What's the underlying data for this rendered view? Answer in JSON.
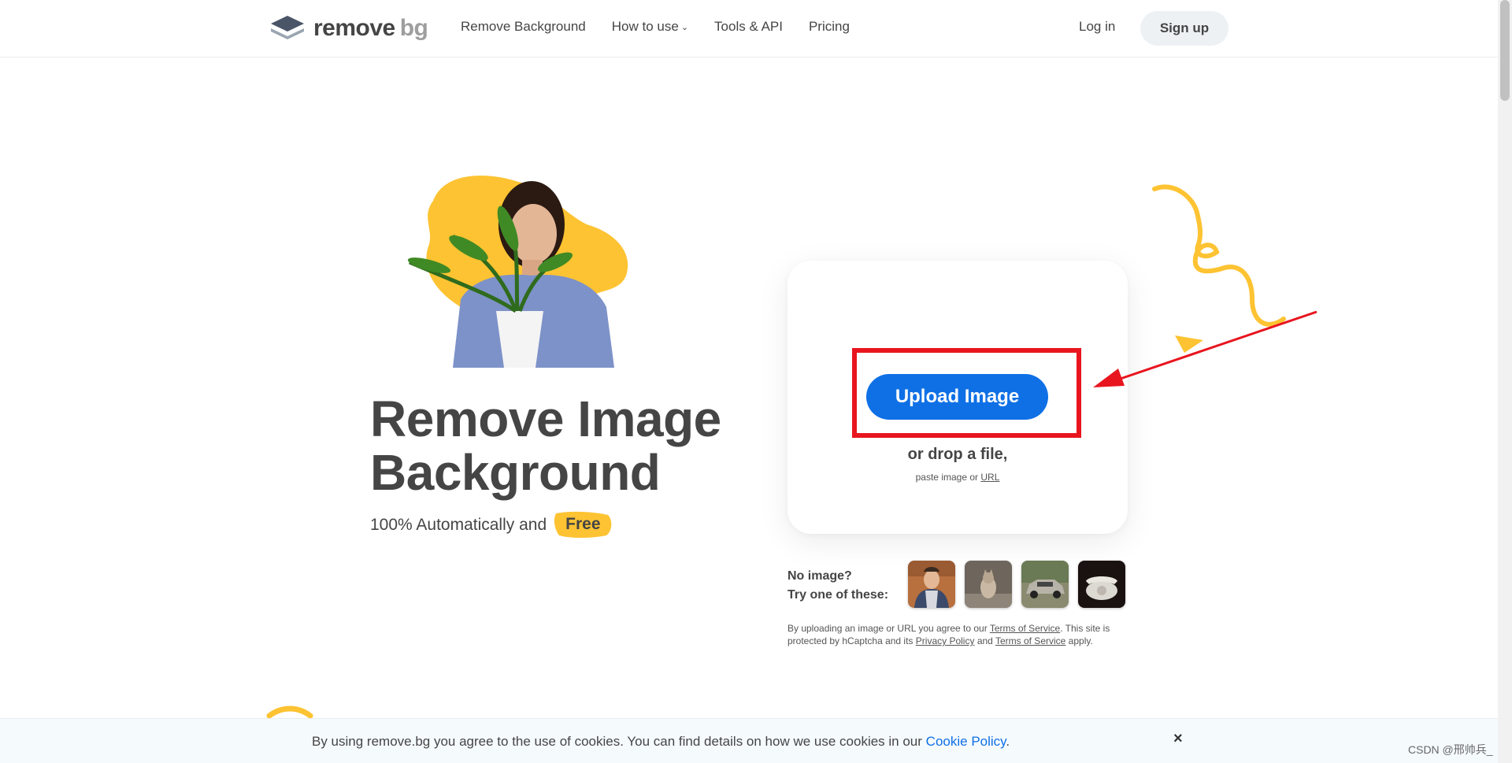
{
  "nav": {
    "logo_word1": "remove",
    "logo_word2": "bg",
    "links": [
      "Remove Background",
      "How to use",
      "Tools & API",
      "Pricing"
    ],
    "login": "Log in",
    "signup": "Sign up"
  },
  "hero": {
    "title_line1": "Remove Image",
    "title_line2": "Background",
    "subtitle": "100% Automatically and",
    "free": "Free"
  },
  "upload": {
    "button": "Upload Image",
    "drop_text": "or drop a file,",
    "paste_prefix": "paste image or",
    "url_link": "URL"
  },
  "samples": {
    "line1": "No image?",
    "line2": "Try one of these:",
    "items": [
      "person",
      "cat",
      "car",
      "telephone"
    ]
  },
  "terms": {
    "t1": "By uploading an image or URL you agree to our",
    "link1": "Terms of Service",
    "t2": ". This site is protected by hCaptcha and its",
    "link2": "Privacy Policy",
    "t3": "and",
    "link3": "Terms of Service",
    "t4": "apply."
  },
  "cookie": {
    "text": "By using remove.bg you agree to the use of cookies. You can find details on how we use cookies in our",
    "link": "Cookie Policy",
    "suffix": ".",
    "close": "×"
  },
  "watermark": "CSDN @邢帅兵_",
  "colors": {
    "primary_blue": "#0f70e6",
    "accent_yellow": "#fdc332",
    "highlight_red": "#e8151f",
    "text_dark": "#454545"
  }
}
